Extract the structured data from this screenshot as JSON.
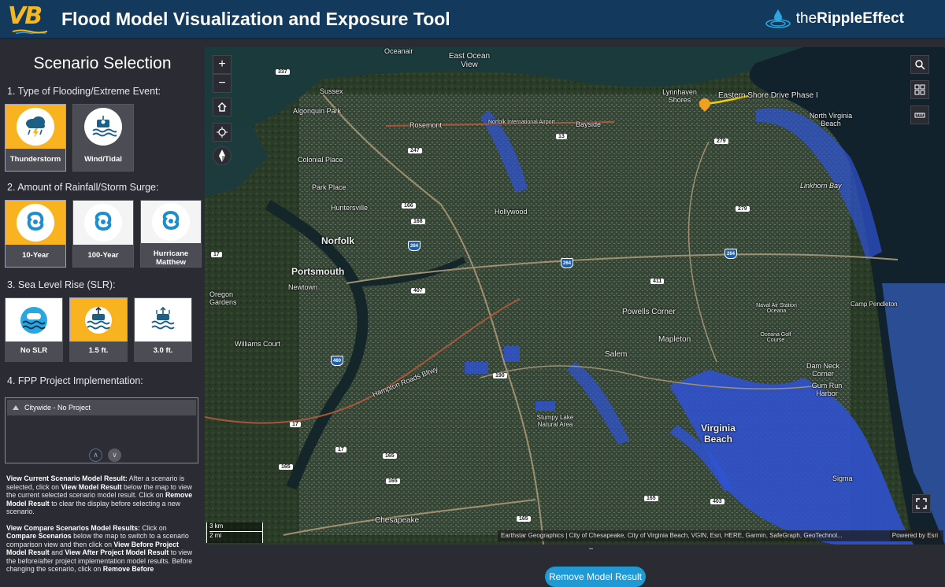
{
  "header": {
    "logo_text": "VB",
    "title": "Flood Model Visualization and Exposure Tool",
    "brand_prefix": "the",
    "brand_bold": "Ripple",
    "brand_suffix": "Effect"
  },
  "sidebar": {
    "title": "Scenario Selection",
    "sections": {
      "flooding": {
        "label": "1.  Type of Flooding/Extreme Event:",
        "options": [
          {
            "label": "Thunderstorm",
            "icon": "thunderstorm-icon",
            "selected": true
          },
          {
            "label": "Wind/Tidal",
            "icon": "wind-tidal-icon",
            "selected": false
          }
        ]
      },
      "rainfall": {
        "label": "2.  Amount of Rainfall/Storm Surge:",
        "options": [
          {
            "label": "10-Year",
            "icon": "hurricane-icon",
            "selected": true
          },
          {
            "label": "100-Year",
            "icon": "hurricane-icon",
            "selected": false
          },
          {
            "label": "Hurricane Matthew",
            "icon": "hurricane-icon",
            "selected": false
          }
        ]
      },
      "slr": {
        "label": "3.  Sea Level Rise (SLR):",
        "options": [
          {
            "label": "No SLR",
            "icon": "sea-level-icon",
            "selected": false
          },
          {
            "label": "1.5 ft.",
            "icon": "sea-level-icon",
            "selected": true
          },
          {
            "label": "3.0 ft.",
            "icon": "sea-level-icon",
            "selected": false
          }
        ]
      },
      "fpp": {
        "label": "4.  FPP Project Implementation:",
        "selected_item": "Citywide - No Project"
      }
    },
    "description": {
      "p1_bold1": "View Current Scenario Model Result:",
      "p1_text1": " After a scenario is selected, click on ",
      "p1_bold2": "View Model Result",
      "p1_text2": " below the map to view the current selected scenario model result. Click on ",
      "p1_bold3": "Remove Model Result",
      "p1_text3": " to clear the display before selecting a new scenario.",
      "p2_bold1": "View Compare Scenarios Model Results:",
      "p2_text1": " Click on ",
      "p2_bold2": "Compare Scenarios",
      "p2_text2": " below the map to switch to a scenario comparison view and then click on ",
      "p2_bold3": "View Before Project Model Result",
      "p2_text3": " and ",
      "p2_bold4": "View After Project Model Result",
      "p2_text4": " to view the before/after project implementation model results. Before changing the scenario, click on ",
      "p2_bold5": "Remove Before"
    }
  },
  "map": {
    "labels": {
      "oceanair": "Oceanair",
      "east_ocean_view": "East Ocean View",
      "sussex": "Sussex",
      "algonquin_park": "Algonquin Park",
      "rosemont": "Rosemont",
      "bayside": "Bayside",
      "colonial_place": "Colonial Place",
      "park_place": "Park Place",
      "huntersville": "Huntersville",
      "hollywood": "Hollywood",
      "norfolk": "Norfolk",
      "portsmouth": "Portsmouth",
      "newtown": "Newtown",
      "oregon_gardens": "Oregon Gardens",
      "powells_corner": "Powells Corner",
      "williams_court": "Williams Court",
      "mapleton": "Mapleton",
      "salem": "Salem",
      "virginia_beach": "Virginia Beach",
      "chesapeake": "Chesapeake",
      "lynnhaven_shores": "Lynnhaven Shores",
      "eastern_shore": "Eastern Shore Drive Phase I",
      "north_virginia_beach": "North Virginia Beach",
      "linkhorn_bay": "Linkhorn Bay",
      "dam_neck_corner": "Dam Neck Corner",
      "gum_run_harbor": "Gum Run Harbor",
      "sigma": "Sigma",
      "hampton_roads_bltwy": "Hampton Roads Bltwy",
      "naval_air_station": "Naval Air Station Oceana",
      "norfolk_intl": "Norfolk International Airport",
      "oceana_gc": "Oceana Golf Course",
      "natural_area": "Stumpy Lake Natural Area",
      "camp_pendleton": "Camp Pendleton"
    },
    "routes": [
      "337",
      "247",
      "13",
      "279",
      "166",
      "168",
      "264",
      "58",
      "407",
      "411",
      "460",
      "464",
      "190",
      "165",
      "17",
      "403",
      "604",
      "225"
    ],
    "scale_km": "3 km",
    "scale_mi": "2 mi",
    "attribution": "Earthstar Geographics | City of Chesapeake, City of Virginia Beach, VGIN, Esri, HERE, Garmin, SafeGraph, GeoTechnol...",
    "powered_by": "Powered by Esri"
  },
  "actions": {
    "remove_model_result": "Remove Model Result"
  },
  "colors": {
    "header_bg": "#133a5c",
    "accent_yellow": "#f9b321",
    "tile_bg": "#4b4c54",
    "button_blue": "#1e9ad6",
    "flood_blue": "#2f52d6"
  }
}
